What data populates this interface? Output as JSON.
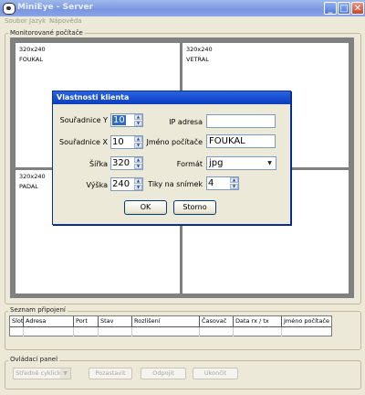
{
  "window": {
    "title": "MiniEye - Server",
    "minimize": "_",
    "maximize": "□",
    "close": "✕"
  },
  "menu": {
    "items": [
      "Soubor",
      "Jazyk",
      "Nápověda"
    ]
  },
  "monitored": {
    "label": "Monitorované počítače",
    "cells": [
      {
        "resolution": "320x240",
        "name": "FOUKAL"
      },
      {
        "resolution": "320x240",
        "name": "VETRAL"
      },
      {
        "resolution": "320x240",
        "name": "PADAL"
      },
      {
        "resolution": "",
        "name": ""
      }
    ]
  },
  "connections": {
    "label": "Seznam připojení",
    "columns": [
      "Slot",
      "Adresa",
      "Port",
      "Stav",
      "Rozlišení",
      "Časovač",
      "Data rx / tx",
      "Jméno počítače"
    ]
  },
  "control_panel": {
    "label": "Ovládací panel",
    "mode_select": "Středně cyklicky",
    "buttons": [
      "Pozastavit",
      "Odpojit",
      "Ukončit"
    ]
  },
  "dialog": {
    "title": "Vlastnosti klienta",
    "coord_y_label": "Souřadnice Y",
    "coord_y": "10",
    "coord_x_label": "Souřadnice X",
    "coord_x": "10",
    "width_label": "Šířka",
    "width": "320",
    "height_label": "Výška",
    "height": "240",
    "ip_label": "IP adresa",
    "ip": "",
    "hostname_label": "Jméno počítače",
    "hostname": "FOUKAL",
    "format_label": "Formát",
    "format": "jpg",
    "ticks_label": "Tiky na snímek",
    "ticks": "4",
    "ok": "OK",
    "cancel": "Storno"
  },
  "colors": {
    "titlebar_inactive": "#7a96df",
    "dialog_title": "#0a3dc0",
    "selection": "#316ac5"
  }
}
